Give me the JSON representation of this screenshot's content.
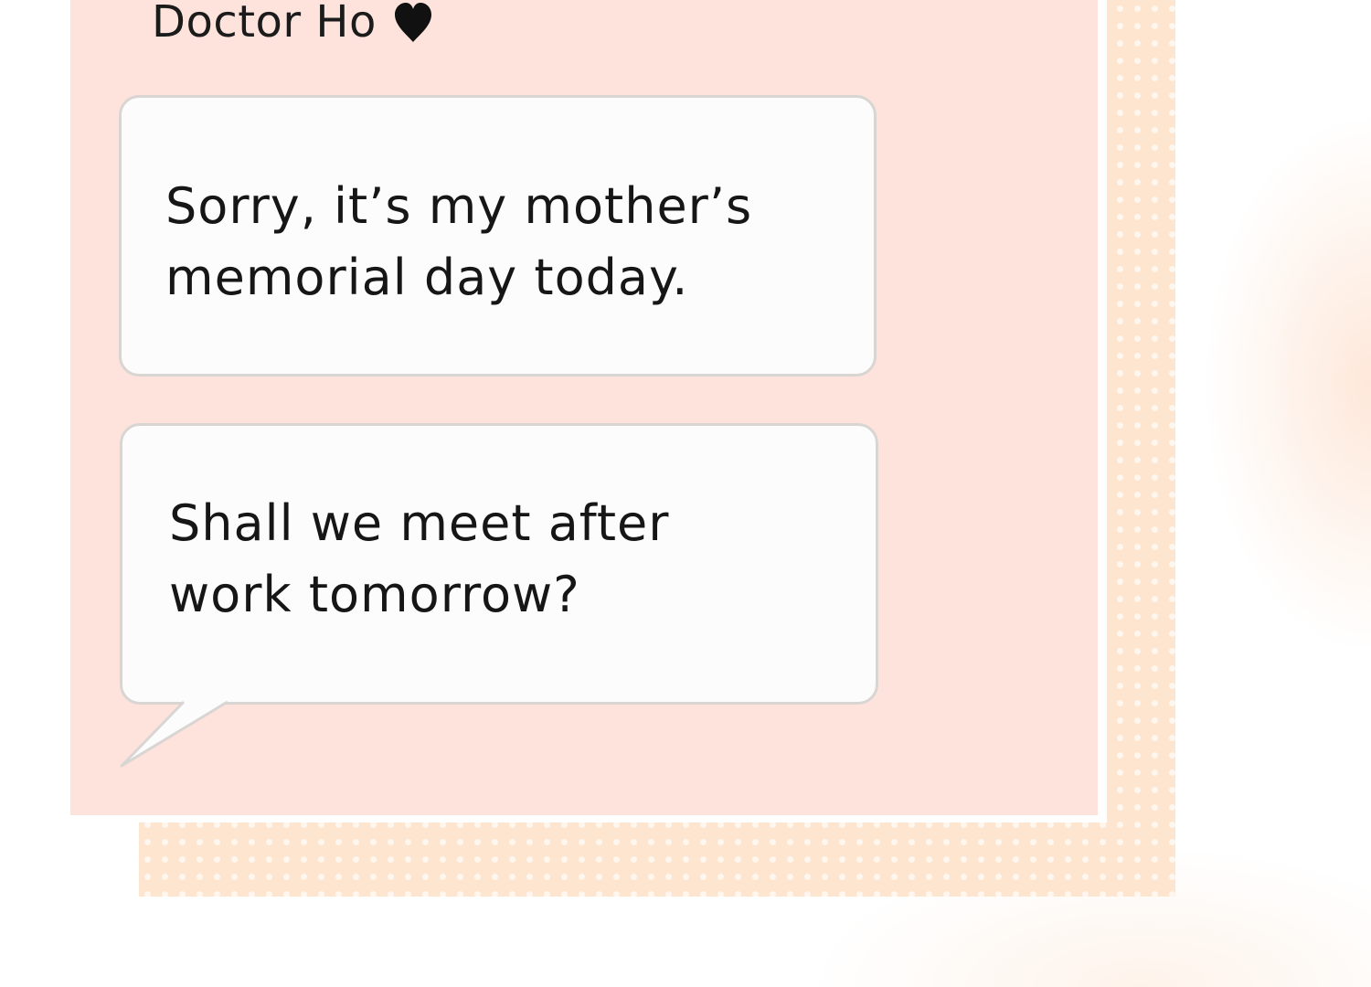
{
  "header": {
    "sender_name": "Doctor Ho"
  },
  "messages": [
    {
      "line1": "Sorry, it’s my mother’s",
      "line2": "memorial day today."
    },
    {
      "line1": "Shall we meet after",
      "line2": "work tomorrow?"
    }
  ],
  "colors": {
    "panel": "#fde3dc",
    "dots_background": "#fde5cf",
    "bubble": "#fcfcfc",
    "bubble_border": "#d9d5d3",
    "text": "#161616"
  },
  "icons": {
    "name_icon": "heart-icon"
  }
}
